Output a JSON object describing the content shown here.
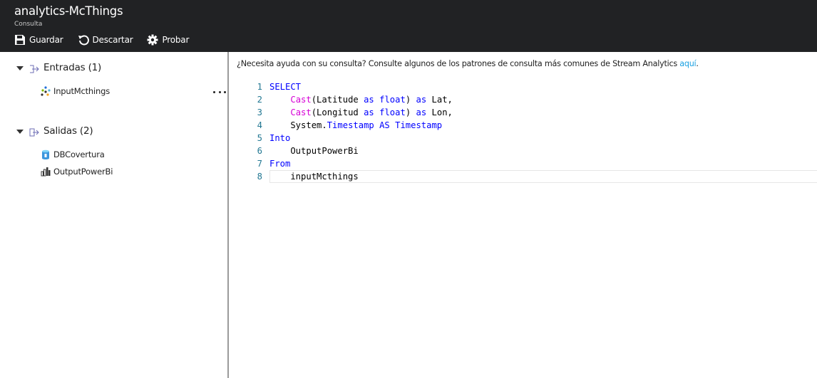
{
  "header": {
    "title": "analytics-McThings",
    "subtitle": "Consulta",
    "toolbar": {
      "save_label": "Guardar",
      "discard_label": "Descartar",
      "test_label": "Probar"
    }
  },
  "sidebar": {
    "inputs": {
      "label": "Entradas (1)",
      "items": [
        {
          "label": "InputMcthings",
          "icon": "stream-input-icon"
        }
      ]
    },
    "outputs": {
      "label": "Salidas (2)",
      "items": [
        {
          "label": "DBCovertura",
          "icon": "database-icon"
        },
        {
          "label": "OutputPowerBi",
          "icon": "powerbi-icon"
        }
      ]
    }
  },
  "editor": {
    "help_text": "¿Necesita ayuda con su consulta? Consulte algunos de los patrones de consulta más comunes de Stream Analytics ",
    "help_link": "aquí",
    "help_end": ".",
    "lines": [
      {
        "num": "1",
        "tokens": [
          {
            "t": "kw",
            "v": "SELECT"
          }
        ]
      },
      {
        "num": "2",
        "tokens": [
          {
            "t": "pu",
            "v": "    "
          },
          {
            "t": "fn",
            "v": "Cast"
          },
          {
            "t": "pu",
            "v": "(Latitude "
          },
          {
            "t": "kw",
            "v": "as"
          },
          {
            "t": "pu",
            "v": " "
          },
          {
            "t": "kw",
            "v": "float"
          },
          {
            "t": "pu",
            "v": ") "
          },
          {
            "t": "kw",
            "v": "as"
          },
          {
            "t": "pu",
            "v": " Lat,"
          }
        ]
      },
      {
        "num": "3",
        "tokens": [
          {
            "t": "pu",
            "v": "    "
          },
          {
            "t": "fn",
            "v": "Cast"
          },
          {
            "t": "pu",
            "v": "(Longitud "
          },
          {
            "t": "kw",
            "v": "as"
          },
          {
            "t": "pu",
            "v": " "
          },
          {
            "t": "kw",
            "v": "float"
          },
          {
            "t": "pu",
            "v": ") "
          },
          {
            "t": "kw",
            "v": "as"
          },
          {
            "t": "pu",
            "v": " Lon,"
          }
        ]
      },
      {
        "num": "4",
        "tokens": [
          {
            "t": "pu",
            "v": "    System."
          },
          {
            "t": "kw",
            "v": "Timestamp AS Timestamp"
          }
        ]
      },
      {
        "num": "5",
        "tokens": [
          {
            "t": "kw",
            "v": "Into"
          }
        ]
      },
      {
        "num": "6",
        "tokens": [
          {
            "t": "pu",
            "v": "    OutputPowerBi"
          }
        ]
      },
      {
        "num": "7",
        "tokens": [
          {
            "t": "kw",
            "v": "From"
          }
        ]
      },
      {
        "num": "8",
        "tokens": [
          {
            "t": "pu",
            "v": "    inputMcthings"
          }
        ]
      }
    ],
    "current_line": 8
  },
  "colors": {
    "header_bg": "#212224",
    "link": "#1ba1e2",
    "keyword": "#0000ff",
    "function": "#d600d6",
    "line_number": "#237893"
  }
}
